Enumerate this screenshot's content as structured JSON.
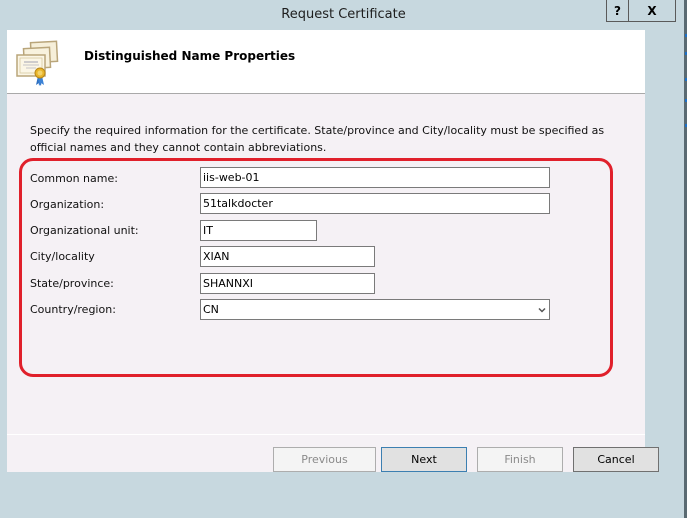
{
  "window": {
    "title": "Request Certificate",
    "help_label": "?",
    "close_label": "X"
  },
  "header": {
    "title": "Distinguished Name Properties",
    "icon": "certificate-icon"
  },
  "description": "Specify the required information for the certificate. State/province and City/locality must be specified as official names and they cannot contain abbreviations.",
  "form": {
    "common_name": {
      "label": "Common name:",
      "value": "iis-web-01"
    },
    "organization": {
      "label": "Organization:",
      "value": "51talkdocter"
    },
    "organizational_unit": {
      "label": "Organizational unit:",
      "value": "IT"
    },
    "city": {
      "label": "City/locality",
      "value": "XIAN"
    },
    "state": {
      "label": "State/province:",
      "value": "SHANNXI"
    },
    "country": {
      "label": "Country/region:",
      "value": "CN"
    }
  },
  "buttons": {
    "previous": "Previous",
    "next": "Next",
    "finish": "Finish",
    "cancel": "Cancel"
  },
  "colors": {
    "highlight_border": "#e0202b",
    "primary_button_border": "#3c7fb1"
  }
}
